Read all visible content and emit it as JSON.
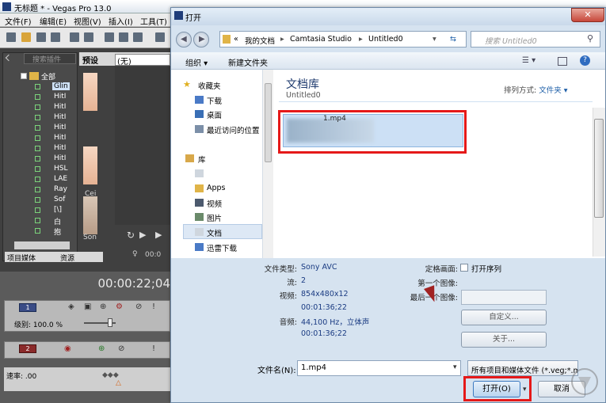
{
  "vegas": {
    "title": "无标题 * - Vegas Pro 13.0",
    "menu": [
      "文件(F)",
      "编辑(E)",
      "视图(V)",
      "插入(I)",
      "工具(T)"
    ],
    "search_placeholder": "搜索插件",
    "tree_root": "全部",
    "tree_items": [
      "Glin",
      "HitI",
      "HitI",
      "HitI",
      "HitI",
      "HitI",
      "HitI",
      "HitI",
      "HSL",
      "LAE",
      "Ray",
      "Sof",
      "[\\]",
      "白",
      "抱"
    ],
    "preview_header": "预设",
    "preview_dropdown": "(无)",
    "thumb_labels": [
      "Cei",
      "Son"
    ],
    "tabs": [
      "项目媒体",
      "资源"
    ],
    "preview_time": "00:0",
    "timecode": "00:00:22;04",
    "track1_num": "1",
    "track1_level": "级别: 100.0 %",
    "track2_num": "2",
    "rate": "速率: .00"
  },
  "dialog": {
    "title": "打开",
    "close": "✕",
    "breadcrumb": [
      "«",
      "我的文档",
      "Camtasia Studio",
      "Untitled0"
    ],
    "search_placeholder": "搜索 Untitled0",
    "organize": "组织 ▾",
    "new_folder": "新建文件夹",
    "nav": {
      "favorites": "收藏夹",
      "downloads": "下载",
      "desktop": "桌面",
      "recent": "最近访问的位置",
      "libraries": "库",
      "apps": "Apps",
      "videos": "视频",
      "pictures": "图片",
      "documents": "文档",
      "xunlei": "迅雷下载"
    },
    "library_title": "文档库",
    "library_sub": "Untitled0",
    "arrange_label": "排列方式:",
    "arrange_value": "文件夹 ▾",
    "file_name_item": "1.mp4",
    "details": {
      "filetype_label": "文件类型:",
      "filetype_value": "Sony AVC",
      "stream_label": "流:",
      "stream_value": "2",
      "video_label": "视频:",
      "video_value": "854x480x12",
      "video_duration": "00:01:36;22",
      "audio_label": "音频:",
      "audio_value": "44,100 Hz，立体声",
      "audio_duration": "00:01:36;22",
      "still_label": "定格画面:",
      "open_seq": "打开序列",
      "first_image": "第一个图像:",
      "last_image": "最后一个图像:",
      "custom": "自定义...",
      "about": "关于..."
    },
    "filename_label": "文件名(N):",
    "filename_value": "1.mp4",
    "filetype_filter": "所有项目和媒体文件 (*.veg;*.m",
    "open_button": "打开(O)",
    "cancel_button": "取消"
  }
}
